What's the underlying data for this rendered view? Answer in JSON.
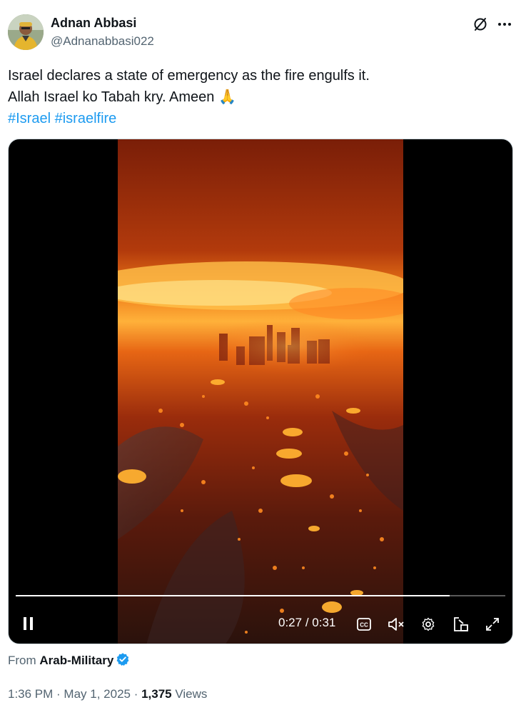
{
  "author": {
    "name": "Adnan Abbasi",
    "handle": "@Adnanabbasi022"
  },
  "tweet": {
    "line1": "Israel declares a state of emergency as the fire engulfs it.",
    "line2": "Allah Israel ko Tabah kry. Ameen 🙏",
    "hashtags": [
      "#Israel",
      "#israelfire"
    ]
  },
  "video": {
    "current_time": "0:27",
    "duration": "0:31",
    "time_separator": " / ",
    "progress_fraction": 0.886
  },
  "source": {
    "prefix": "From ",
    "account": "Arab-Military"
  },
  "meta": {
    "time": "1:36 PM",
    "date": "May 1, 2025",
    "separator": " · ",
    "views_count": "1,375",
    "views_label": " Views"
  },
  "colors": {
    "link": "#1d9bf0",
    "text": "#0f1419",
    "secondary": "#536471",
    "verified": "#1d9bf0"
  },
  "icons": [
    "grok-icon",
    "more-icon",
    "pause-icon",
    "captions-icon",
    "mute-icon",
    "settings-icon",
    "pip-icon",
    "fullscreen-icon",
    "verified-badge-icon"
  ]
}
